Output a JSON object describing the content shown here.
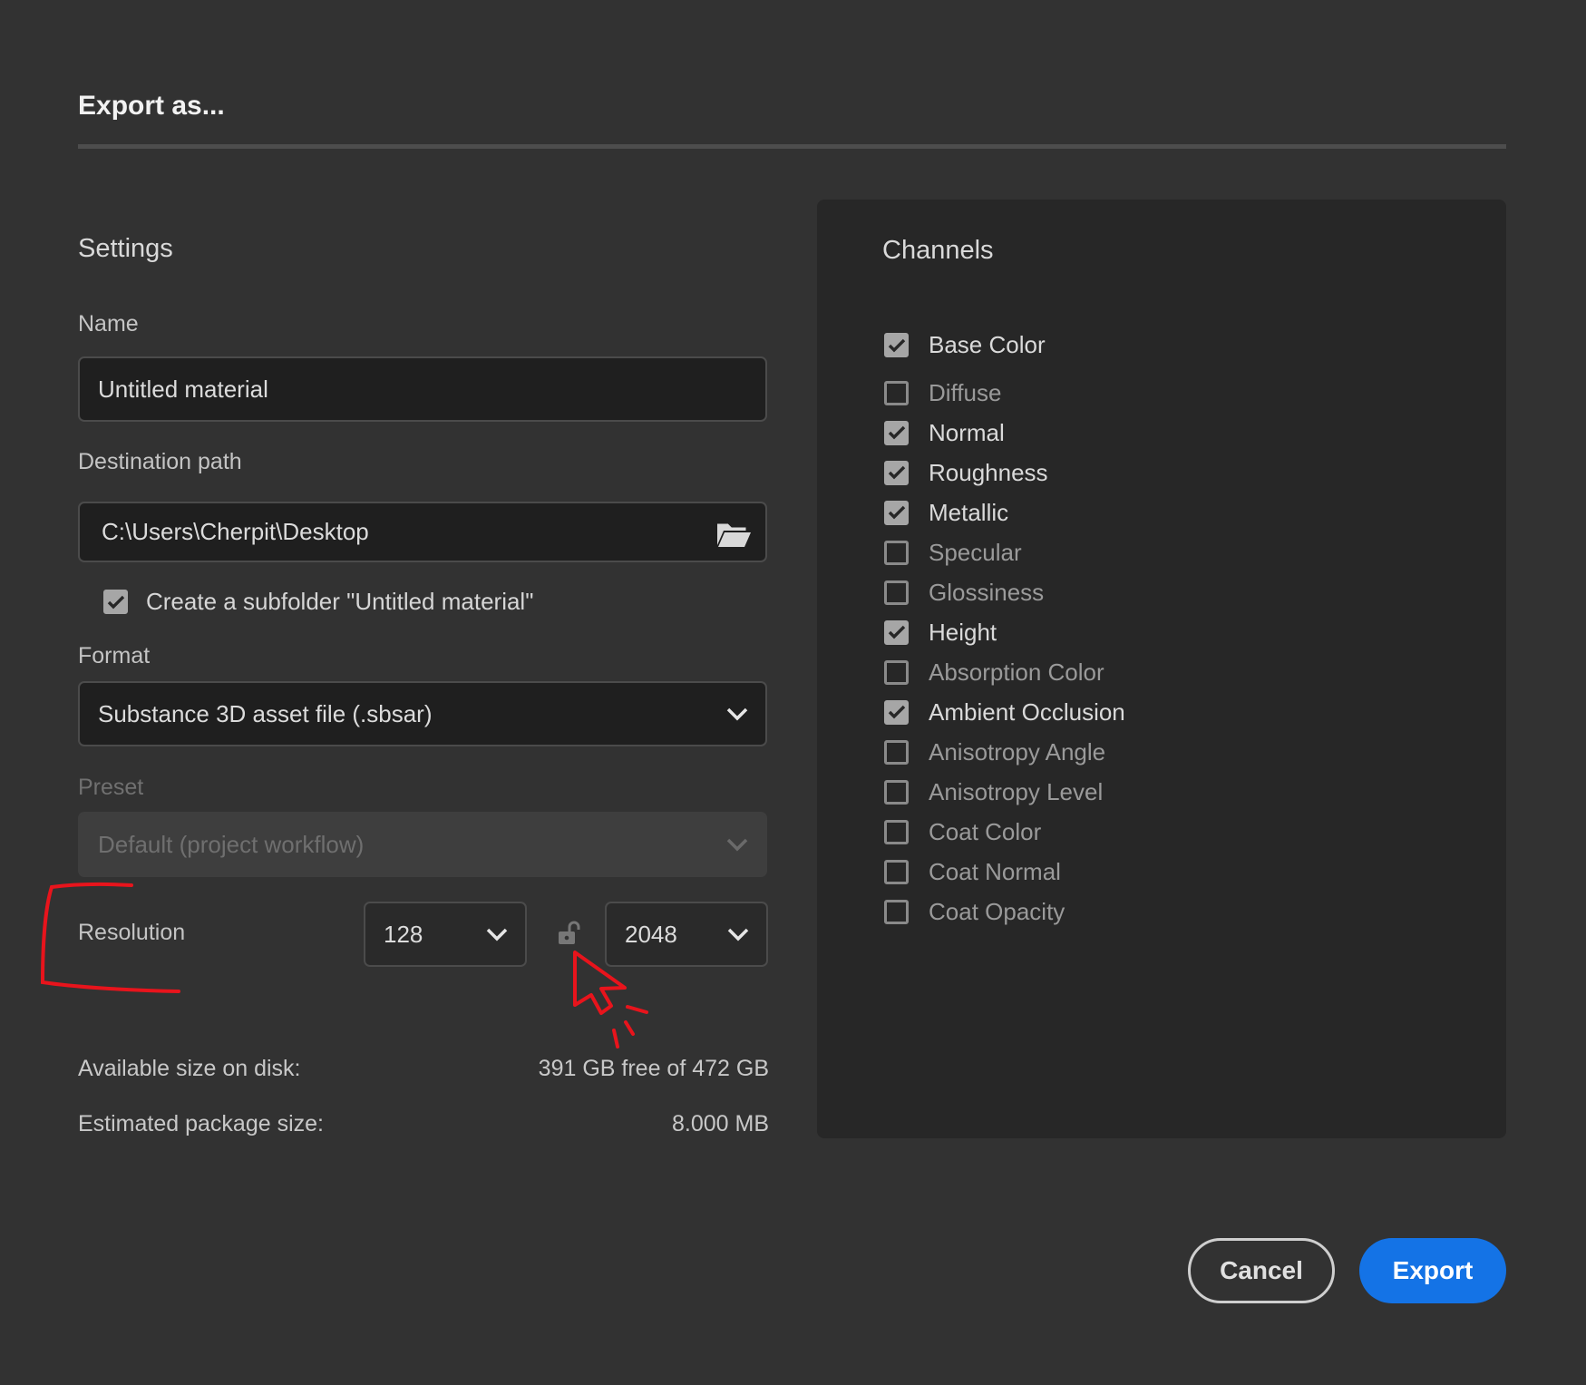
{
  "dialog": {
    "title": "Export as..."
  },
  "settings": {
    "heading": "Settings",
    "name": {
      "label": "Name",
      "value": "Untitled material"
    },
    "destination": {
      "label": "Destination path",
      "value": "C:\\Users\\Cherpit\\Desktop",
      "icon": "folder-open-icon"
    },
    "subfolder": {
      "label": "Create a subfolder \"Untitled material\"",
      "checked": true
    },
    "format": {
      "label": "Format",
      "value": "Substance 3D asset file (.sbsar)"
    },
    "preset": {
      "label": "Preset",
      "value": "Default (project workflow)",
      "disabled": true
    },
    "resolution": {
      "label": "Resolution",
      "width": "128",
      "height": "2048",
      "lock_icon": "unlock-icon",
      "locked": false
    },
    "disk": {
      "label": "Available size on disk:",
      "value": "391 GB free of 472 GB"
    },
    "package": {
      "label": "Estimated package size:",
      "value": "8.000 MB"
    }
  },
  "channels": {
    "heading": "Channels",
    "items": [
      {
        "label": "Base Color",
        "checked": true
      },
      {
        "label": "Diffuse",
        "checked": false
      },
      {
        "label": "Normal",
        "checked": true
      },
      {
        "label": "Roughness",
        "checked": true
      },
      {
        "label": "Metallic",
        "checked": true
      },
      {
        "label": "Specular",
        "checked": false
      },
      {
        "label": "Glossiness",
        "checked": false
      },
      {
        "label": "Height",
        "checked": true
      },
      {
        "label": "Absorption Color",
        "checked": false
      },
      {
        "label": "Ambient Occlusion",
        "checked": true
      },
      {
        "label": "Anisotropy Angle",
        "checked": false
      },
      {
        "label": "Anisotropy Level",
        "checked": false
      },
      {
        "label": "Coat Color",
        "checked": false
      },
      {
        "label": "Coat Normal",
        "checked": false
      },
      {
        "label": "Coat Opacity",
        "checked": false
      }
    ]
  },
  "buttons": {
    "cancel": "Cancel",
    "export": "Export"
  },
  "colors": {
    "accent": "#1473e6",
    "annotation": "#e8141c",
    "background": "#323232",
    "panel": "#272727"
  }
}
